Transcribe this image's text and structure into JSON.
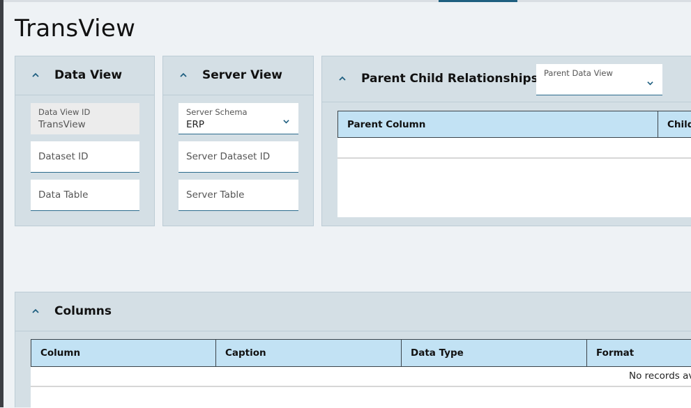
{
  "page": {
    "title": "TransView"
  },
  "data_view": {
    "title": "Data View",
    "data_view_id": {
      "label": "Data View ID",
      "value": "TransView"
    },
    "dataset_id": {
      "placeholder": "Dataset ID"
    },
    "data_table": {
      "placeholder": "Data Table"
    }
  },
  "server_view": {
    "title": "Server View",
    "server_schema": {
      "label": "Server Schema",
      "value": "ERP"
    },
    "server_dataset_id": {
      "placeholder": "Server Dataset ID"
    },
    "server_table": {
      "placeholder": "Server Table"
    }
  },
  "parent_child": {
    "title": "Parent Child Relationships",
    "parent_data_view": {
      "label": "Parent Data View",
      "value": ""
    },
    "columns": [
      "Parent Column",
      "Child"
    ]
  },
  "columns_panel": {
    "title": "Columns",
    "columns": [
      "Column",
      "Caption",
      "Data Type",
      "Format"
    ],
    "empty_text": "No records av"
  },
  "colors": {
    "page_bg": "#eef2f5",
    "panel_bg": "#d4dfe5",
    "grid_header_bg": "#c2e2f4",
    "accent": "#1f5f80"
  }
}
